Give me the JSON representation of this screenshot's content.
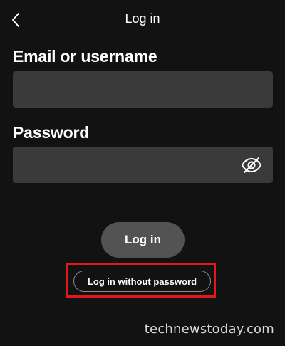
{
  "header": {
    "title": "Log in",
    "back_icon": "chevron-left-icon"
  },
  "form": {
    "email_label": "Email or username",
    "email_value": "",
    "email_placeholder": "",
    "password_label": "Password",
    "password_value": "",
    "password_placeholder": "",
    "visibility_icon": "eye-off-icon"
  },
  "actions": {
    "login_label": "Log in",
    "login_without_password_label": "Log in without password"
  },
  "watermark": {
    "text": "technewstoday.com"
  },
  "colors": {
    "background": "#121212",
    "input_background": "#3a3a3a",
    "button_disabled": "#535353",
    "highlight": "#e01a1a",
    "text": "#ffffff"
  }
}
